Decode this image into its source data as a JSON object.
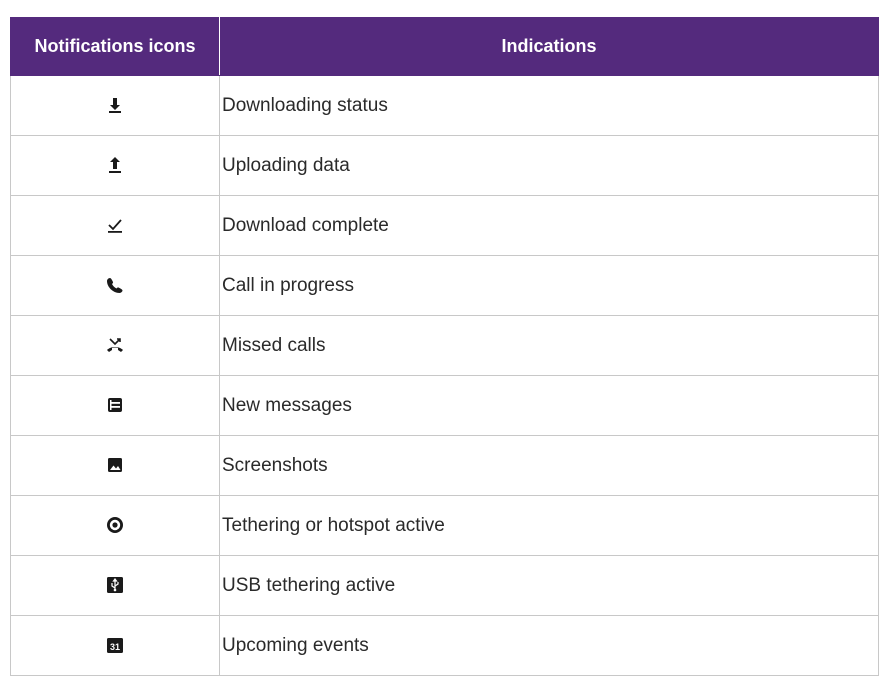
{
  "header": {
    "col_icons": "Notifications icons",
    "col_indications": "Indications"
  },
  "rows": [
    {
      "icon": "download-arrow-icon",
      "indication": "Downloading status"
    },
    {
      "icon": "upload-arrow-icon",
      "indication": "Uploading data"
    },
    {
      "icon": "download-complete-check-icon",
      "indication": "Download complete"
    },
    {
      "icon": "phone-call-icon",
      "indication": "Call in progress"
    },
    {
      "icon": "missed-call-icon",
      "indication": "Missed calls"
    },
    {
      "icon": "message-icon",
      "indication": "New messages"
    },
    {
      "icon": "screenshot-image-icon",
      "indication": "Screenshots"
    },
    {
      "icon": "hotspot-icon",
      "indication": "Tethering or hotspot active"
    },
    {
      "icon": "usb-icon",
      "indication": "USB tethering active"
    },
    {
      "icon": "calendar-icon",
      "indication": "Upcoming events",
      "icon_text": "31"
    }
  ]
}
